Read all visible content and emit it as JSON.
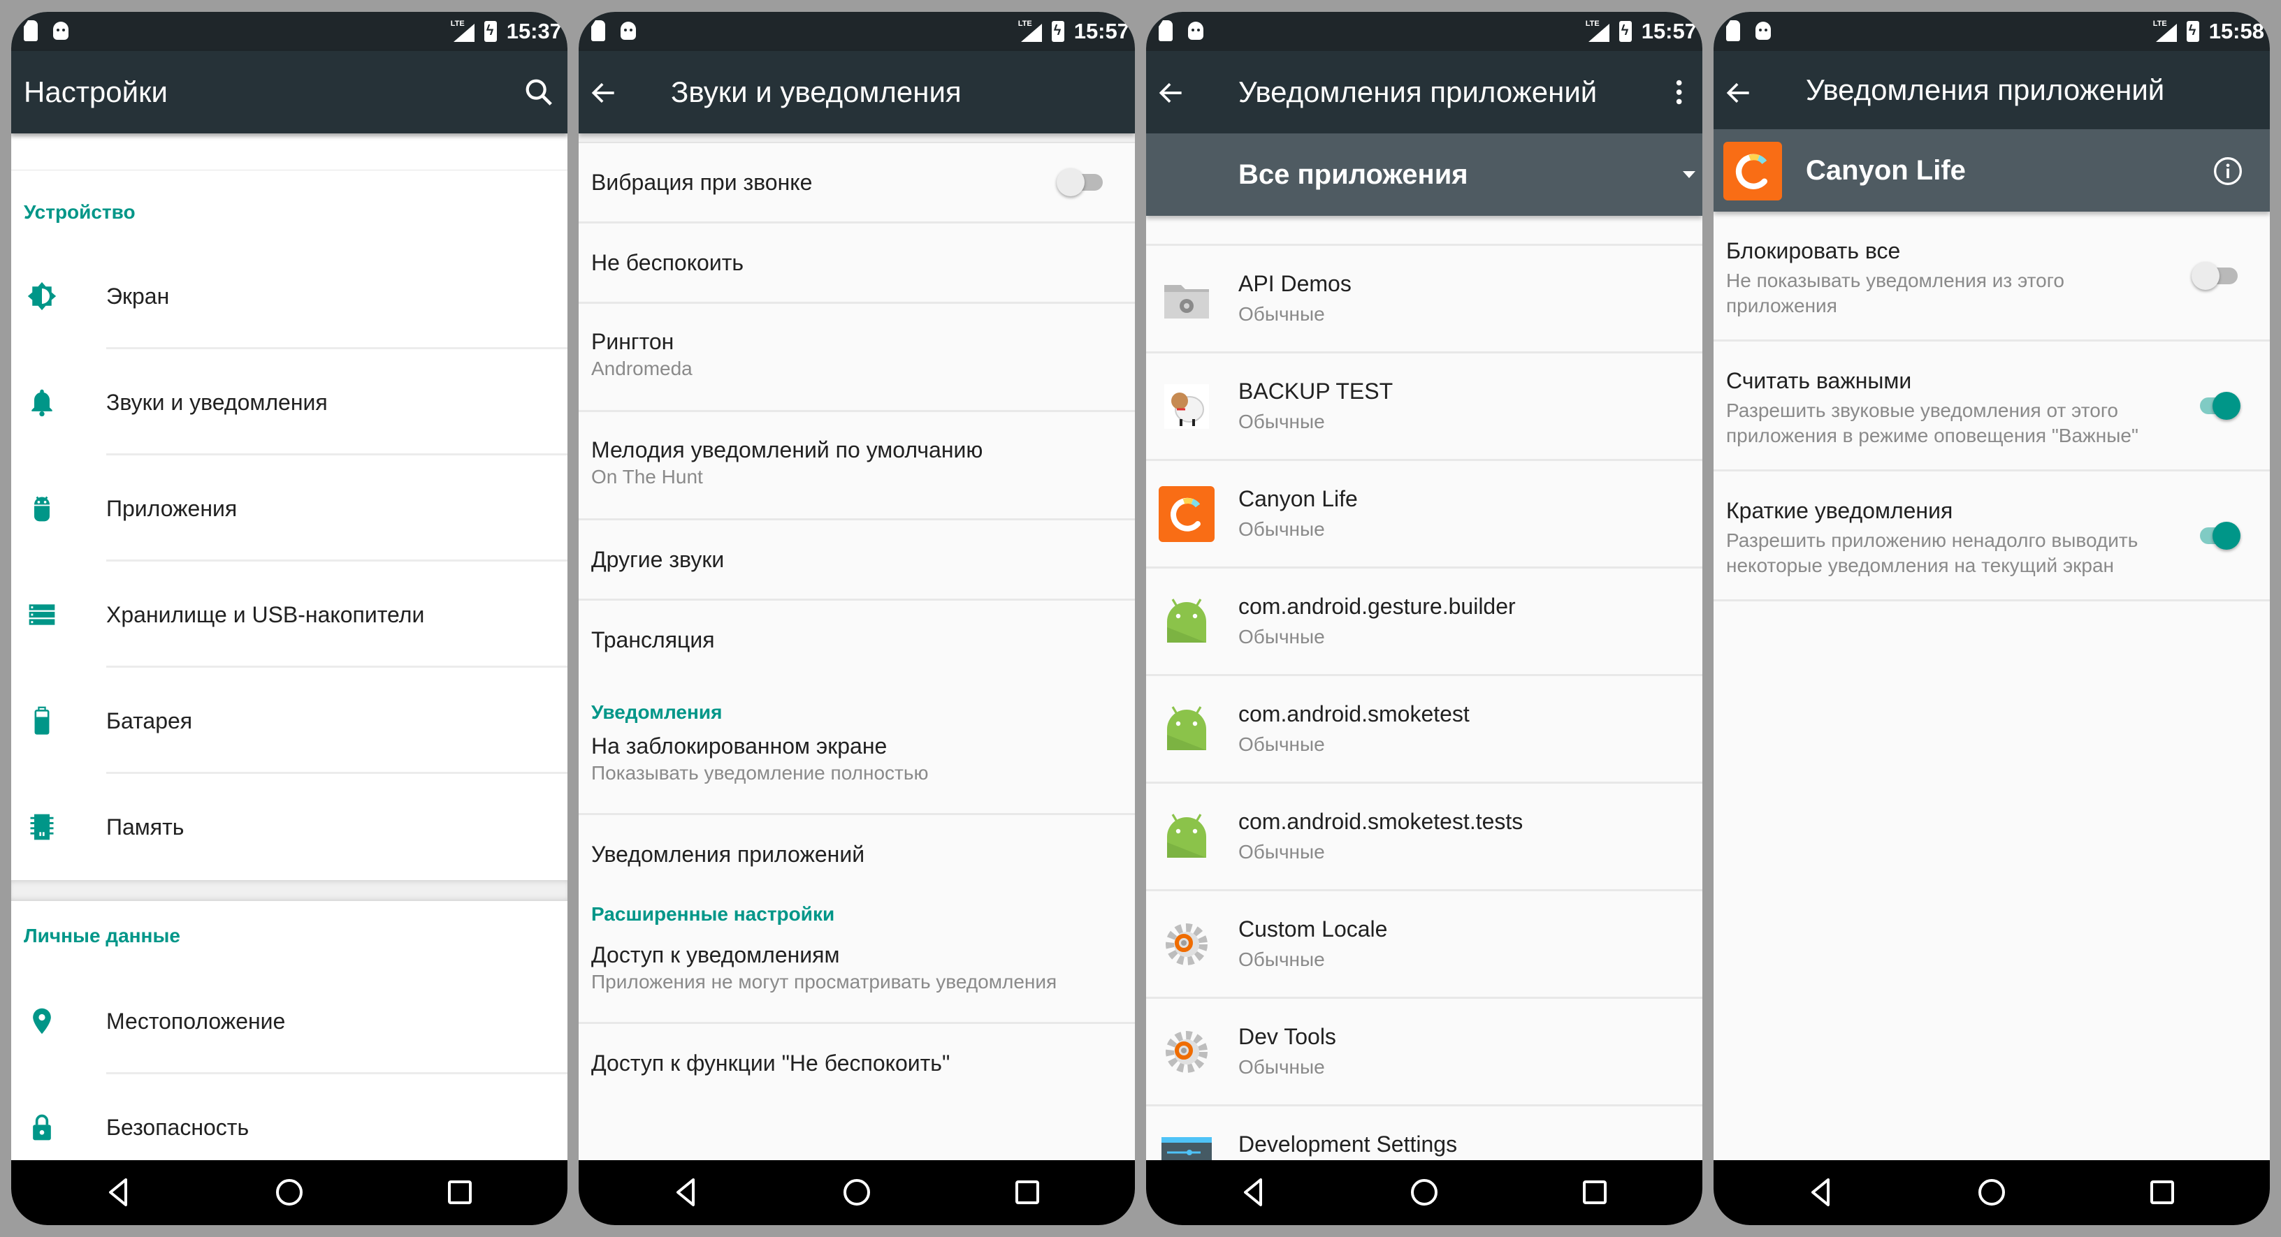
{
  "colors": {
    "accent": "#009688",
    "appbar": "#263238",
    "statusbar": "#1f262a",
    "subbar": "#4f5b62",
    "canyon_orange": "#f96d15",
    "android_green": "#8bc34a"
  },
  "screens": [
    {
      "status": {
        "time": "15:37",
        "network": "LTE"
      },
      "appbar": {
        "title": "Настройки",
        "action_icon": "search-icon"
      },
      "sections": [
        {
          "header": "Устройство",
          "items": [
            {
              "label": "Экран",
              "icon": "brightness-icon"
            },
            {
              "label": "Звуки и уведомления",
              "icon": "bell-icon"
            },
            {
              "label": "Приложения",
              "icon": "android-icon"
            },
            {
              "label": "Хранилище и USB-накопители",
              "icon": "storage-icon"
            },
            {
              "label": "Батарея",
              "icon": "battery-icon"
            },
            {
              "label": "Память",
              "icon": "memory-icon"
            }
          ]
        },
        {
          "header": "Личные данные",
          "items": [
            {
              "label": "Местоположение",
              "icon": "location-icon"
            },
            {
              "label": "Безопасность",
              "icon": "lock-icon"
            }
          ]
        }
      ]
    },
    {
      "status": {
        "time": "15:57",
        "network": "LTE"
      },
      "appbar": {
        "title": "Звуки и уведомления"
      },
      "items": {
        "vibrate": {
          "title": "Вибрация при звонке",
          "enabled": false
        },
        "dnd": {
          "title": "Не беспокоить"
        },
        "ringtone": {
          "title": "Рингтон",
          "summary": "Andromeda"
        },
        "notif_sound": {
          "title": "Мелодия уведомлений по умолчанию",
          "summary": "On The Hunt"
        },
        "other_sounds": {
          "title": "Другие звуки"
        },
        "cast": {
          "title": "Трансляция"
        },
        "notifications_header": "Уведомления",
        "lockscreen": {
          "title": "На заблокированном экране",
          "summary": "Показывать уведомление полностью"
        },
        "app_notifications": {
          "title": "Уведомления приложений"
        },
        "advanced_header": "Расширенные настройки",
        "notif_access": {
          "title": "Доступ к уведомлениям",
          "summary": "Приложения не могут просматривать уведомления"
        },
        "dnd_access": {
          "title": "Доступ к функции \"Не беспокоить\""
        }
      }
    },
    {
      "status": {
        "time": "15:57",
        "network": "LTE"
      },
      "appbar": {
        "title": "Уведомления приложений",
        "action_icon": "more-vert-icon"
      },
      "filter": {
        "selected": "Все приложения"
      },
      "apps": [
        {
          "name": "API Demos",
          "category": "Обычные",
          "icon": "folder-gear-icon"
        },
        {
          "name": "BACKUP TEST",
          "category": "Обычные",
          "icon": "sheep-icon"
        },
        {
          "name": "Canyon Life",
          "category": "Обычные",
          "icon": "canyon-life-icon"
        },
        {
          "name": "com.android.gesture.builder",
          "category": "Обычные",
          "icon": "android-app-icon"
        },
        {
          "name": "com.android.smoketest",
          "category": "Обычные",
          "icon": "android-app-icon"
        },
        {
          "name": "com.android.smoketest.tests",
          "category": "Обычные",
          "icon": "android-app-icon"
        },
        {
          "name": "Custom Locale",
          "category": "Обычные",
          "icon": "gears-icon"
        },
        {
          "name": "Dev Tools",
          "category": "Обычные",
          "icon": "gears-icon"
        },
        {
          "name": "Development Settings",
          "category": "",
          "icon": "dev-settings-icon"
        }
      ]
    },
    {
      "status": {
        "time": "15:58",
        "network": "LTE"
      },
      "appbar": {
        "title": "Уведомления приложений"
      },
      "app": {
        "name": "Canyon Life"
      },
      "prefs": [
        {
          "title": "Блокировать все",
          "summary": "Не показывать уведомления из этого приложения",
          "enabled": false
        },
        {
          "title": "Считать важными",
          "summary": "Разрешить звуковые уведомления от этого приложения в режиме оповещения \"Важные\"",
          "enabled": true
        },
        {
          "title": "Краткие уведомления",
          "summary": "Разрешить приложению ненадолго выводить некоторые уведомления на текущий экран",
          "enabled": true
        }
      ]
    }
  ]
}
